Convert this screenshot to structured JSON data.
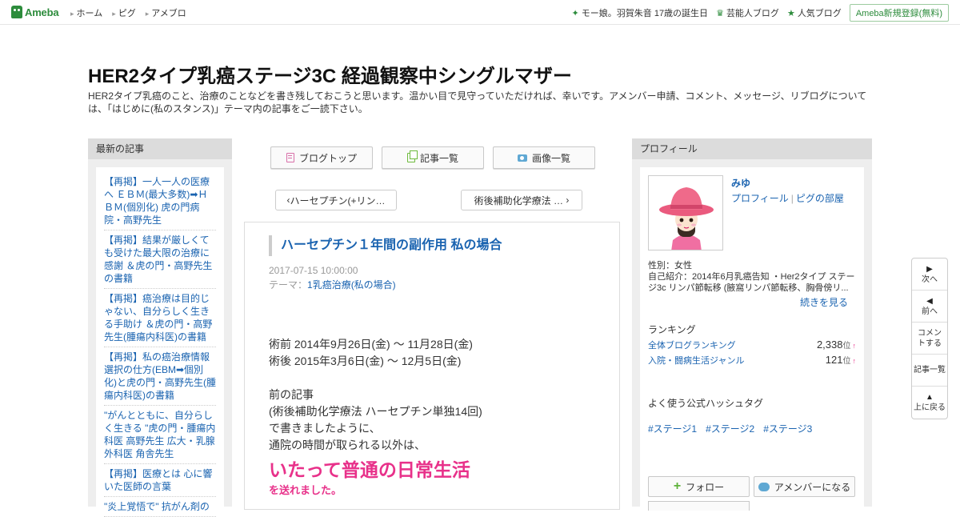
{
  "topbar": {
    "logo": "Ameba",
    "nav": [
      "ホーム",
      "ピグ",
      "アメブロ"
    ],
    "right_links": [
      {
        "label": "モー娘。羽賀朱音 17歳の誕生日",
        "icon": "sparkle-icon"
      },
      {
        "label": "芸能人ブログ",
        "icon": "crown-icon"
      },
      {
        "label": "人気ブログ",
        "icon": "star-icon"
      }
    ],
    "signup": "Ameba新規登録(無料)"
  },
  "blog": {
    "title": "HER2タイプ乳癌ステージ3C 経過観察中シングルマザー",
    "description": "HER2タイプ乳癌のこと、治療のことなどを書き残しておこうと思います。温かい目で見守っていただければ、幸いです。アメンバー申請、コメント、メッセージ、リブログについては、「はじめに(私のスタンス)」テーマ内の記事をご一読下さい。"
  },
  "left": {
    "heading": "最新の記事",
    "items": [
      "【再掲】一人一人の医療へ ＥＢＭ(最大多数)➡ＨＢＭ(個別化) 虎の門病院・高野先生",
      "【再掲】結果が厳しくても受けた最大限の治療に感謝 ＆虎の門・高野先生の書籍",
      "【再掲】癌治療は目的じゃない、自分らしく生きる手助け ＆虎の門・高野先生(腫瘍内科医)の書籍",
      "【再掲】私の癌治療情報選択の仕方(EBM➡個別化)と虎の門・高野先生(腫瘍内科医)の書籍",
      "\"がんとともに、自分らしく生きる \"虎の門・腫瘍内科医 高野先生 広大・乳腺外科医 角舎先生",
      "【再掲】医療とは 心に響いた医師の言葉",
      "\"炎上覚悟で\" 抗がん剤の"
    ]
  },
  "center": {
    "tabs": [
      {
        "label": "ブログトップ",
        "icon": "blog-icon"
      },
      {
        "label": "記事一覧",
        "icon": "list-icon"
      },
      {
        "label": "画像一覧",
        "icon": "camera-icon"
      }
    ],
    "prev": "ハーセプチン(+リン…",
    "next": "術後補助化学療法 …",
    "article": {
      "title": "ハーセプチン１年間の副作用 私の場合",
      "date": "2017-07-15 10:00:00",
      "theme_label": "テーマ：",
      "theme": "1乳癌治療(私の場合)",
      "line1": "術前 2014年9月26日(金) ～ 11月28日(金)",
      "line2": "術後 2015年3月6日(金) ～ 12月5日(金)",
      "line3": "前の記事",
      "line4": "(術後補助化学療法 ハーセプチン単独14回)",
      "line5": "で書きましたように、",
      "line6": "通院の時間が取られる以外は、",
      "highlight": "いたって普通の日常生活",
      "highlight2": "を送れました。"
    }
  },
  "right": {
    "heading": "プロフィール",
    "name": "みゆ",
    "profile_link": "プロフィール",
    "pig_link": "ピグの部屋",
    "gender": "性別：女性",
    "intro": "自己紹介：2014年6月乳癌告知 ・Her2タイプ ステージ3c リンパ節転移 (腋窩リンパ節転移、胸骨傍リ...",
    "more": "続きを見る",
    "ranking_head": "ランキング",
    "rankings": [
      {
        "label": "全体ブログランキング",
        "value": "2,338",
        "unit": "位",
        "trend": "↑"
      },
      {
        "label": "入院・闘病生活ジャンル",
        "value": "121",
        "unit": "位",
        "trend": "↑"
      }
    ],
    "hashtag_head": "よく使う公式ハッシュタグ",
    "hashtags": [
      "#ステージ1",
      "#ステージ2",
      "#ステージ3"
    ],
    "follow": "フォロー",
    "member": "アメンバーになる"
  },
  "floatnav": [
    {
      "arrow": "▶",
      "label": "次へ"
    },
    {
      "arrow": "◀",
      "label": "前へ"
    },
    {
      "arrow": "",
      "label": "コメントする"
    },
    {
      "arrow": "",
      "label": "記事一覧"
    },
    {
      "arrow": "▲",
      "label": "上に戻る"
    }
  ],
  "colors": {
    "accent": "#1a63b0",
    "brand": "#2d8c3c",
    "highlight": "#e8318a"
  }
}
